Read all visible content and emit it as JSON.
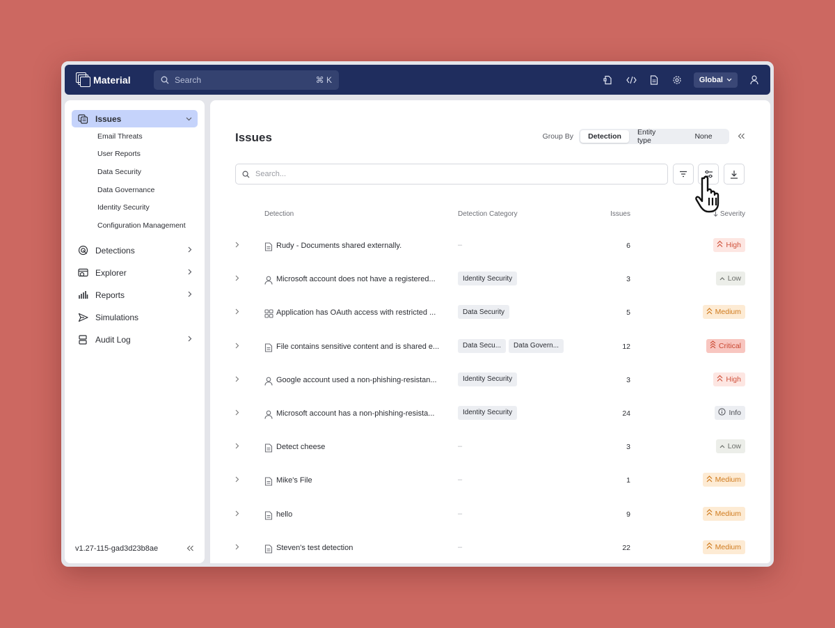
{
  "colors": {
    "topbar": "#1f2d5e",
    "active_nav": "#c5d3fb",
    "high_bg": "#fde6e2",
    "high_fg": "#d0533d",
    "critical_bg": "#f8c6c0",
    "critical_fg": "#c9462f",
    "medium_bg": "#fdebd4",
    "medium_fg": "#cf7a1d",
    "low_bg": "#eceee9",
    "low_fg": "#6b6e6a",
    "info_bg": "#eceef2",
    "info_fg": "#4a4c52"
  },
  "topbar": {
    "app_name": "Material",
    "search_placeholder": "Search",
    "search_shortcut": "⌘ K",
    "icons": [
      "integrations-icon",
      "code-icon",
      "document-icon",
      "settings-icon"
    ],
    "scope_label": "Global"
  },
  "sidebar": {
    "active": {
      "label": "Issues",
      "icon": "issues-icon"
    },
    "sub_items": [
      "Email Threats",
      "User Reports",
      "Data Security",
      "Data Governance",
      "Identity Security",
      "Configuration Management"
    ],
    "items": [
      {
        "label": "Detections",
        "icon": "detections-icon",
        "has_children": true
      },
      {
        "label": "Explorer",
        "icon": "explorer-icon",
        "has_children": true
      },
      {
        "label": "Reports",
        "icon": "reports-icon",
        "has_children": true
      },
      {
        "label": "Simulations",
        "icon": "simulations-icon",
        "has_children": false
      },
      {
        "label": "Audit Log",
        "icon": "audit-log-icon",
        "has_children": true
      }
    ],
    "version": "v1.27-115-gad3d23b8ae"
  },
  "main": {
    "title": "Issues",
    "group_by_label": "Group By",
    "group_by_options": [
      "Detection",
      "Entity type",
      "None"
    ],
    "group_by_selected": "Detection",
    "search_placeholder": "Search...",
    "columns": {
      "detection": "Detection",
      "category": "Detection Category",
      "issues": "Issues",
      "severity": "Severity"
    },
    "rows": [
      {
        "icon": "document-icon",
        "detection": "Rudy - Documents shared externally.",
        "categories": [],
        "issues": "6",
        "severity": "High"
      },
      {
        "icon": "user-icon",
        "detection": "Microsoft account does not have a registered...",
        "categories": [
          "Identity Security"
        ],
        "issues": "3",
        "severity": "Low"
      },
      {
        "icon": "apps-icon",
        "detection": "Application has OAuth access with restricted ...",
        "categories": [
          "Data Security"
        ],
        "issues": "5",
        "severity": "Medium"
      },
      {
        "icon": "document-icon",
        "detection": "File contains sensitive content and is shared e...",
        "categories": [
          "Data Secu...",
          "Data Govern..."
        ],
        "issues": "12",
        "severity": "Critical"
      },
      {
        "icon": "user-icon",
        "detection": "Google account used a non-phishing-resistan...",
        "categories": [
          "Identity Security"
        ],
        "issues": "3",
        "severity": "High"
      },
      {
        "icon": "user-icon",
        "detection": "Microsoft account has a non-phishing-resista...",
        "categories": [
          "Identity Security"
        ],
        "issues": "24",
        "severity": "Info"
      },
      {
        "icon": "document-icon",
        "detection": "Detect cheese",
        "categories": [],
        "issues": "3",
        "severity": "Low"
      },
      {
        "icon": "document-icon",
        "detection": "Mike's File",
        "categories": [],
        "issues": "1",
        "severity": "Medium"
      },
      {
        "icon": "document-icon",
        "detection": "hello",
        "categories": [],
        "issues": "9",
        "severity": "Medium"
      },
      {
        "icon": "document-icon",
        "detection": "Steven's test detection",
        "categories": [],
        "issues": "22",
        "severity": "Medium"
      }
    ]
  }
}
